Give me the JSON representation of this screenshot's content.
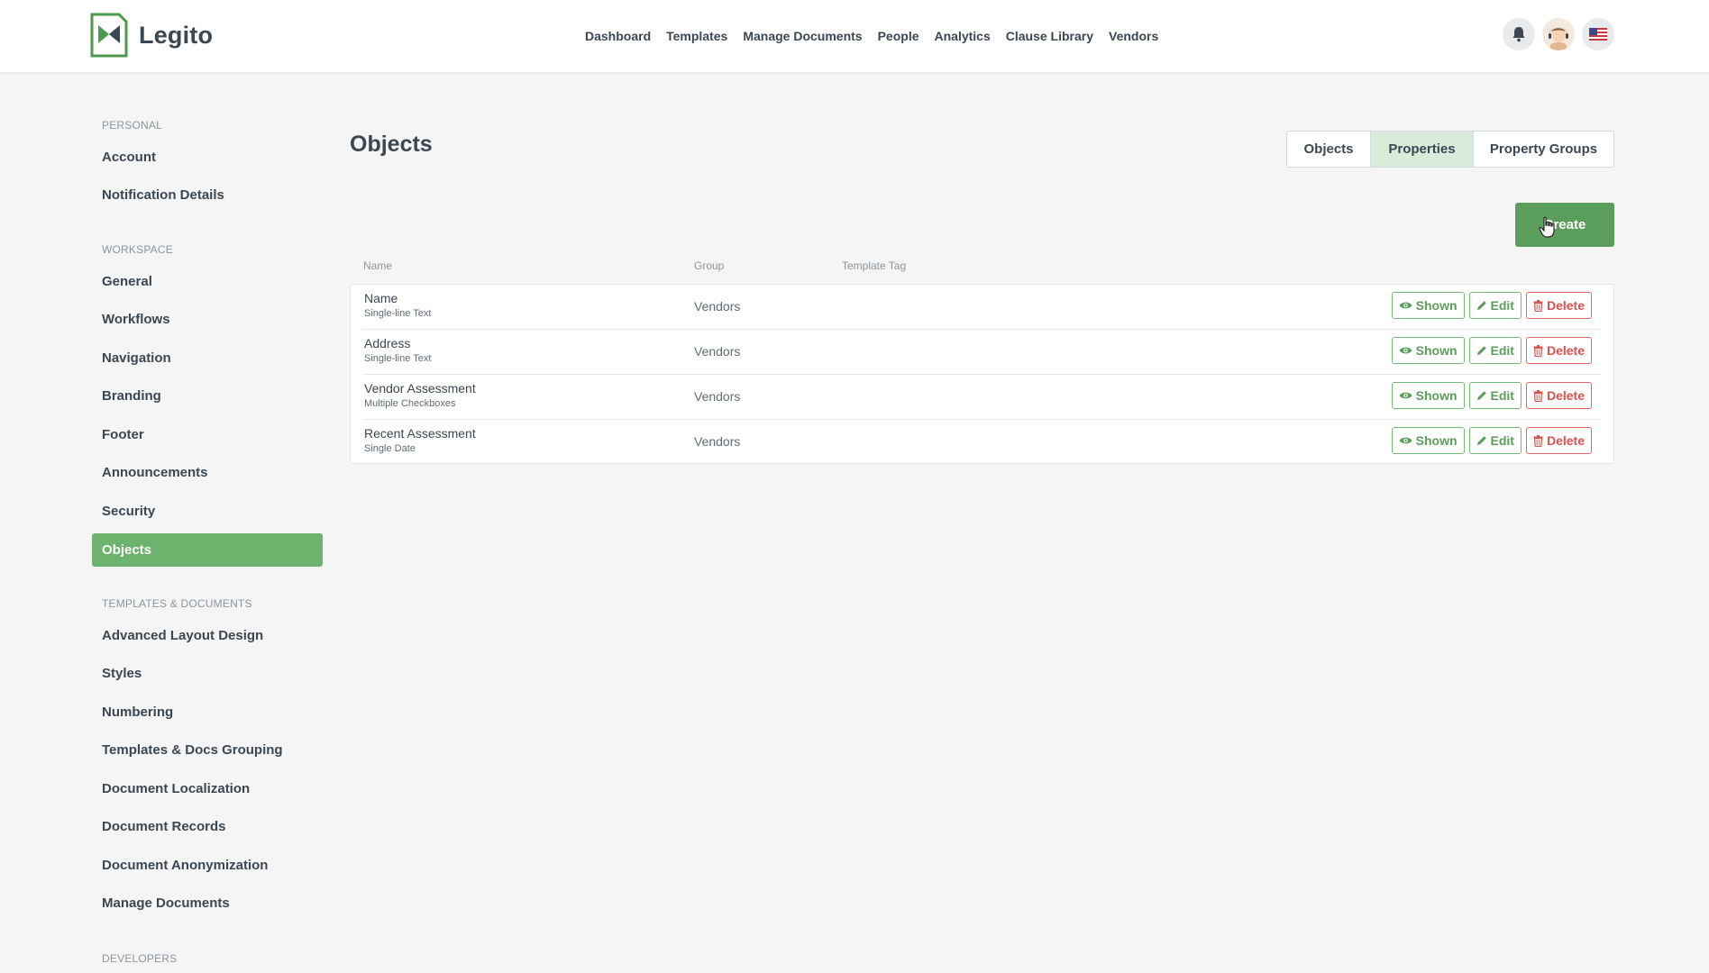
{
  "app": {
    "name": "Legito"
  },
  "nav": [
    {
      "label": "Dashboard"
    },
    {
      "label": "Templates"
    },
    {
      "label": "Manage Documents"
    },
    {
      "label": "People"
    },
    {
      "label": "Analytics"
    },
    {
      "label": "Clause Library"
    },
    {
      "label": "Vendors"
    }
  ],
  "top_icons": [
    "bell-icon",
    "avatar",
    "us-flag-icon"
  ],
  "sidebar": {
    "sections": [
      {
        "title": "PERSONAL"
      },
      {
        "title": "WORKSPACE"
      },
      {
        "title": "TEMPLATES & DOCUMENTS"
      },
      {
        "title": "DEVELOPERS"
      }
    ],
    "items": [
      {
        "label": "Account"
      },
      {
        "label": "Notification Details"
      },
      {
        "label": "General"
      },
      {
        "label": "Workflows"
      },
      {
        "label": "Navigation"
      },
      {
        "label": "Branding"
      },
      {
        "label": "Footer"
      },
      {
        "label": "Announcements"
      },
      {
        "label": "Security"
      },
      {
        "label": "Objects",
        "active": true
      },
      {
        "label": "Advanced Layout Design"
      },
      {
        "label": "Styles"
      },
      {
        "label": "Numbering"
      },
      {
        "label": "Templates & Docs Grouping"
      },
      {
        "label": "Document Localization"
      },
      {
        "label": "Document Records"
      },
      {
        "label": "Document Anonymization"
      },
      {
        "label": "Manage Documents"
      }
    ]
  },
  "main": {
    "title": "Objects",
    "tabs": [
      {
        "label": "Objects"
      },
      {
        "label": "Properties",
        "active": true
      },
      {
        "label": "Property Groups"
      }
    ],
    "create_label": "Create",
    "columns": {
      "name": "Name",
      "group": "Group",
      "template_tag": "Template Tag"
    },
    "rows": [
      {
        "name": "Name",
        "type": "Single-line Text",
        "group": "Vendors"
      },
      {
        "name": "Address",
        "type": "Single-line Text",
        "group": "Vendors"
      },
      {
        "name": "Vendor Assessment",
        "type": "Multiple Checkboxes",
        "group": "Vendors"
      },
      {
        "name": "Recent Assessment",
        "type": "Single Date",
        "group": "Vendors"
      }
    ],
    "actions": {
      "shown": "Shown",
      "edit": "Edit",
      "delete": "Delete"
    }
  },
  "colors": {
    "accent": "#6db36d",
    "accent_dark": "#5b9e5b",
    "danger": "#d9534f",
    "text": "#3b4752"
  }
}
